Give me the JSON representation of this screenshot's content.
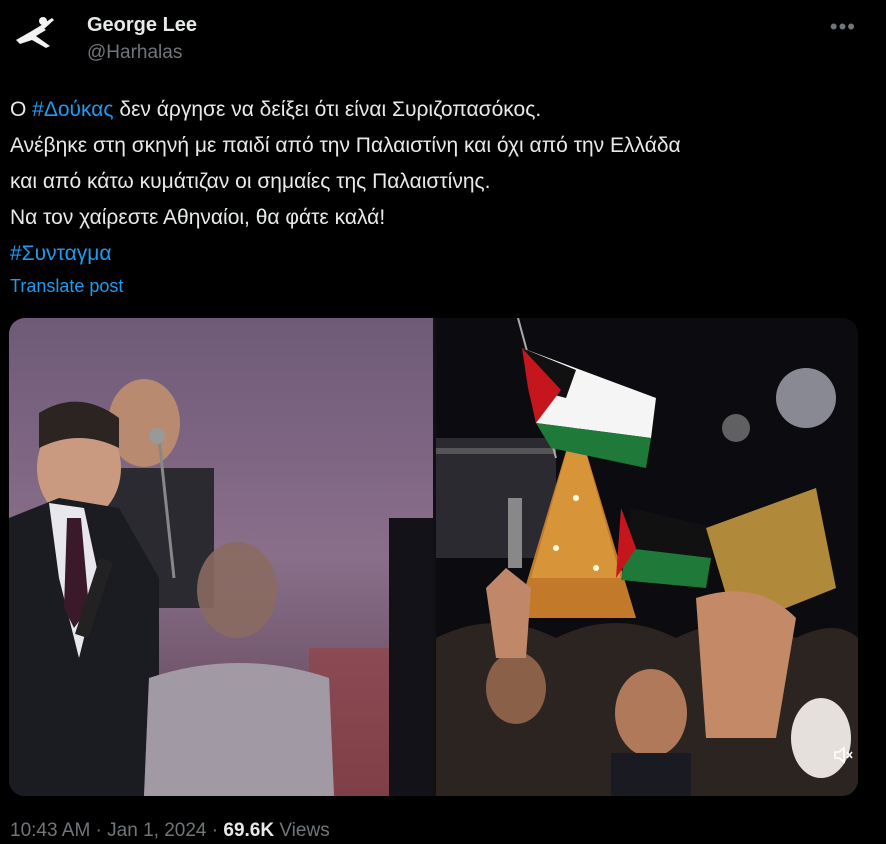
{
  "author": {
    "name": "George Lee",
    "handle": "@Harhalas"
  },
  "icons": {
    "avatar": "karate-kick-avatar-icon",
    "more": "more-options-icon",
    "mute": "volume-mute-icon"
  },
  "post": {
    "line1_pre": "Ο ",
    "line1_tag": "#Δούκας",
    "line1_post": " δεν άργησε να δείξει ότι είναι Συριζοπασόκος.",
    "line2": "Ανέβηκε στη σκηνή με παιδί από την Παλαιστίνη και όχι από την Ελλάδα",
    "line3": "και από κάτω κυμάτιζαν οι σημαίες της Παλαιστίνης.",
    "line4": "Να τον χαίρεστε Αθηναίοι, θα φάτε καλά!",
    "tag2": "#Συνταγμα",
    "translate": "Translate post"
  },
  "footer": {
    "time": "10:43 AM",
    "sep1": " · ",
    "date": "Jan 1, 2024",
    "sep2": " · ",
    "views_count": "69.6K",
    "views_label": " Views"
  },
  "colors": {
    "background": "#000000",
    "text": "#e7e9ea",
    "muted": "#71767b",
    "link": "#1d9bf0"
  }
}
